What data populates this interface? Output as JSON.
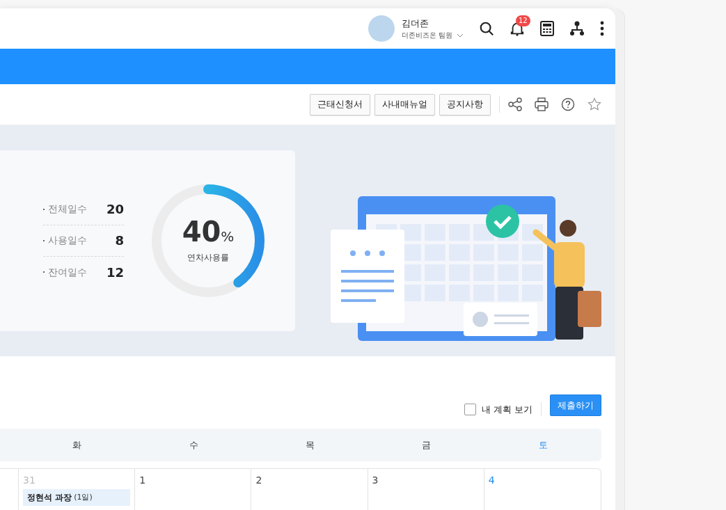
{
  "header": {
    "user": {
      "name": "김더존",
      "team": "더존비즈온 팀원"
    },
    "notifications": {
      "count": "12"
    }
  },
  "toolbar": {
    "buttons": [
      "근태신청서",
      "사내매뉴얼",
      "공지사항"
    ],
    "favorite": false
  },
  "summary": {
    "stats": [
      {
        "label": "전체일수",
        "value": "20"
      },
      {
        "label": "사용일수",
        "value": "8"
      },
      {
        "label": "잔여일수",
        "value": "12"
      }
    ],
    "usage": {
      "number": "40",
      "unit": "%",
      "caption": "연차사용률",
      "level": 0.4
    }
  },
  "controls": {
    "my_plan": {
      "label": "내 계획 보기",
      "checked": false
    },
    "submit": "제출하기"
  },
  "calendar": {
    "weekdays": [
      {
        "label": "화",
        "kind": "weekday"
      },
      {
        "label": "수",
        "kind": "weekday"
      },
      {
        "label": "목",
        "kind": "weekday"
      },
      {
        "label": "금",
        "kind": "weekday"
      },
      {
        "label": "토",
        "kind": "saturday"
      }
    ],
    "days": [
      {
        "date": "31",
        "kind": "other-month",
        "events": [
          {
            "name": "정현석 과장",
            "duration": "(1일)"
          }
        ]
      },
      {
        "date": "1",
        "kind": "normal"
      },
      {
        "date": "2",
        "kind": "normal"
      },
      {
        "date": "3",
        "kind": "normal"
      },
      {
        "date": "4",
        "kind": "saturday"
      }
    ]
  }
}
